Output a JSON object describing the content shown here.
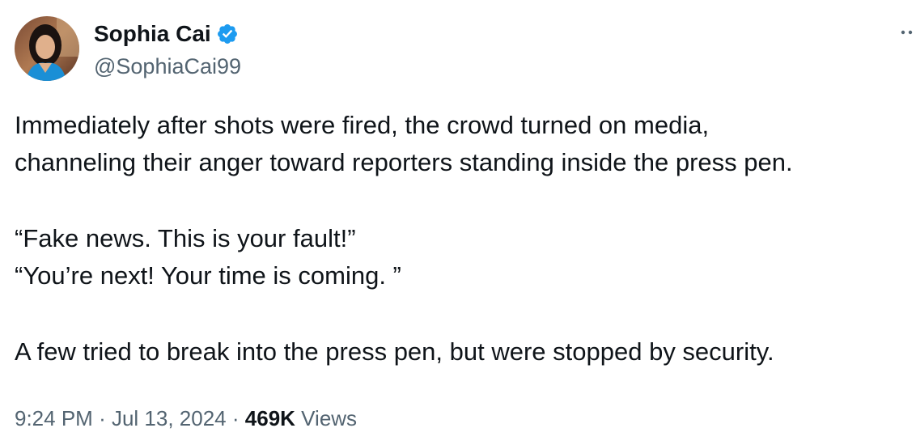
{
  "author": {
    "display_name": "Sophia Cai",
    "handle": "@SophiaCai99",
    "verified": true,
    "avatar_icon": "profile-photo",
    "verified_icon": "verified-badge-icon",
    "verified_color": "#1d9bf0"
  },
  "tweet": {
    "lines": [
      "Immediately after shots were fired, the crowd turned on media,",
      "channeling their anger toward reporters standing inside the press pen.",
      "",
      "“Fake news. This is your fault!”",
      "“You’re next! Your time is coming. ”",
      "",
      "A few tried to break into the press pen, but were stopped by security."
    ]
  },
  "meta": {
    "time": "9:24 PM",
    "separator": "·",
    "date": "Jul 13, 2024",
    "views_count": "469K",
    "views_label": "Views"
  },
  "colors": {
    "text_primary": "#0f1419",
    "text_secondary": "#536471",
    "background": "#ffffff"
  }
}
